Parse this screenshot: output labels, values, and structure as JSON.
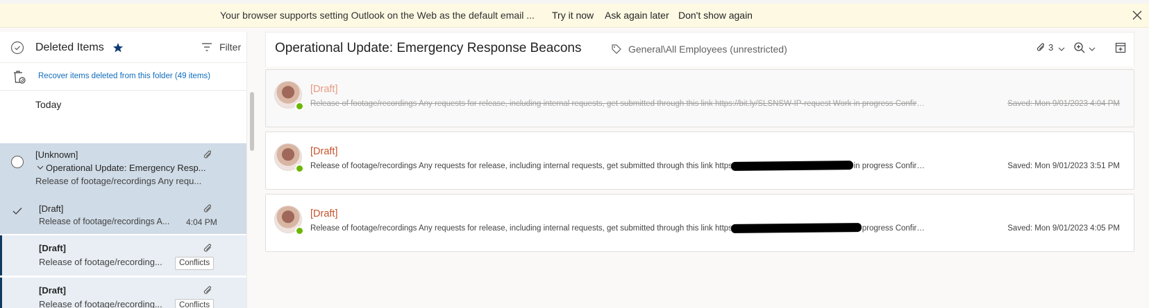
{
  "banner": {
    "message": "Your browser supports setting Outlook on the Web as the default email ...",
    "try_it_now": "Try it now",
    "ask_again_later": "Ask again later",
    "dont_show_again": "Don't show again"
  },
  "folder": {
    "title": "Deleted Items",
    "filter_label": "Filter",
    "recover_text": "Recover items deleted from this folder (49 items)",
    "group_label": "Today"
  },
  "conversation": {
    "sender": "[Unknown]",
    "subject": "Operational Update: Emergency Resp...",
    "preview": "Release of footage/recordings Any requ...",
    "selected_item": {
      "label": "[Draft]",
      "preview": "Release of footage/recordings A...",
      "time": "4:04 PM"
    },
    "children": [
      {
        "label": "[Draft]",
        "preview": "Release of footage/recording...",
        "badge": "Conflicts"
      },
      {
        "label": "[Draft]",
        "preview": "Release of footage/recording...",
        "badge": "Conflicts"
      }
    ]
  },
  "reading": {
    "subject": "Operational Update: Emergency Response Beacons",
    "sensitivity_label": "General\\All Employees (unrestricted)",
    "attachment_count": "3",
    "messages": [
      {
        "label": "[Draft]",
        "body": "Release of footage/recordings Any requests for release, including internal requests, get submitted through this link https://bit.ly/SLSNSW-IP-request Work in progress Confirmi...",
        "saved": "Saved: Mon 9/01/2023 4:04 PM"
      },
      {
        "label": "[Draft]",
        "body": "Release of footage/recordings Any requests for release, including internal requests, get submitted through this link https://bit.ly/SLSNSW-IP-request Work in progress Confirmi...",
        "saved": "Saved: Mon 9/01/2023 3:51 PM"
      },
      {
        "label": "[Draft]",
        "body": "Release of footage/recordings Any requests for release, including internal requests, get submitted through this link https://bit.ly/SLSNSW-IP-request Work in progress Confirmi...",
        "saved": "Saved: Mon 9/01/2023 4:05 PM"
      }
    ]
  },
  "colors": {
    "accent": "#0f6cbd",
    "draft_label": "#c4532a",
    "selected_row": "#cfdbe6",
    "banner_bg": "#fdf9e3",
    "presence": "#6bb700"
  }
}
